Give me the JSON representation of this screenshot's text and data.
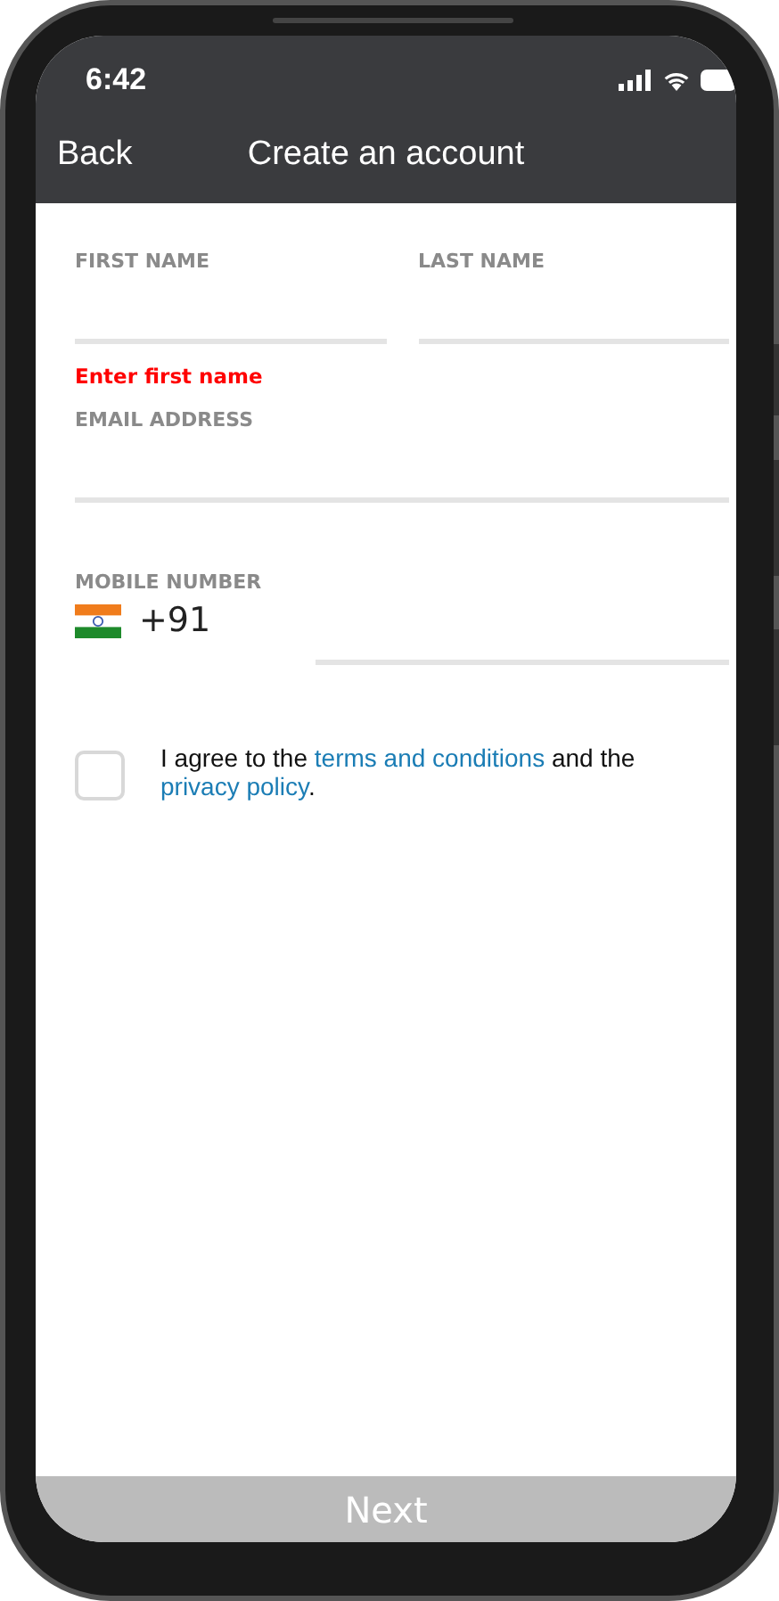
{
  "status_bar": {
    "time": "6:42"
  },
  "nav_bar": {
    "back": "Back",
    "title": "Create an account"
  },
  "form": {
    "first_name": {
      "label": "FIRST NAME",
      "error": "Enter first name"
    },
    "last_name": {
      "label": "LAST NAME"
    },
    "email": {
      "label": "EMAIL ADDRESS"
    },
    "mobile": {
      "label": "MOBILE NUMBER",
      "country_code": "+91"
    },
    "agreement": {
      "checked": false,
      "parts": [
        {
          "kind": "text",
          "text": "I agree to the "
        },
        {
          "kind": "link",
          "text": "terms and conditions"
        },
        {
          "kind": "text",
          "text": " and the "
        },
        {
          "kind": "link",
          "text": "privacy policy"
        },
        {
          "kind": "text",
          "text": "."
        }
      ]
    }
  },
  "next_button": {
    "label": "Next",
    "disabled": true
  }
}
